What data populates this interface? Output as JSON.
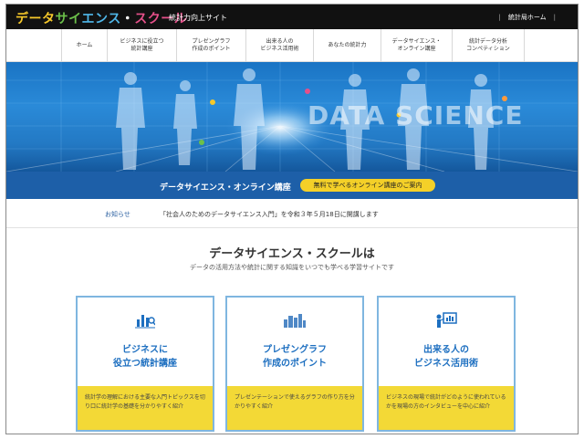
{
  "header": {
    "logo_parts": [
      "データ",
      "サイ",
      "エンス",
      "・",
      "スクール"
    ],
    "logo_colors": [
      "#f6c82a",
      "#6cc04a",
      "#4fb6e8",
      "#ffffff",
      "#e6508a"
    ],
    "subtitle": "統計力向上サイト",
    "portal_link": "統計局ホーム"
  },
  "nav": {
    "items": [
      {
        "label": "ホーム"
      },
      {
        "label": "ビジネスに役立つ\n統計講座"
      },
      {
        "label": "プレゼングラフ\n作成のポイント"
      },
      {
        "label": "出来る人の\nビジネス活用術"
      },
      {
        "label": "あなたの統計力"
      },
      {
        "label": "データサイエンス・\nオンライン講座"
      },
      {
        "label": "統計データ分析\nコンペティション"
      }
    ]
  },
  "hero": {
    "watermark": "DATA SCIENCE",
    "accent_colors": [
      "#f6c82a",
      "#e6508a",
      "#6cc04a",
      "#ff9a3c"
    ]
  },
  "banner": {
    "title": "データサイエンス・オンライン講座",
    "button": "無料で学べるオンライン講座のご案内"
  },
  "notice": {
    "label": "お知らせ",
    "text": "「社会人のためのデータサイエンス入門」を令和３年５月18日に開講します"
  },
  "intro": {
    "title": "データサイエンス・スクールは",
    "subtitle": "データの活用方法や統計に関する知識をいつでも学べる学習サイトです"
  },
  "cards": [
    {
      "icon": "bar-chart-icon",
      "title": "ビジネスに\n役立つ統計講座",
      "desc": "統計学の理解における主要な入門トピックスを切り口に統計学の基礎を分かりやすく紹介"
    },
    {
      "icon": "cityscape-chart-icon",
      "title": "プレゼングラフ\n作成のポイント",
      "desc": "プレゼンテーションで使えるグラフの作り方を分かりやすく紹介"
    },
    {
      "icon": "presenter-board-icon",
      "title": "出来る人の\nビジネス活用術",
      "desc": "ビジネスの現場で統計がどのように使われているかを現場の方のインタビューを中心に紹介"
    }
  ]
}
